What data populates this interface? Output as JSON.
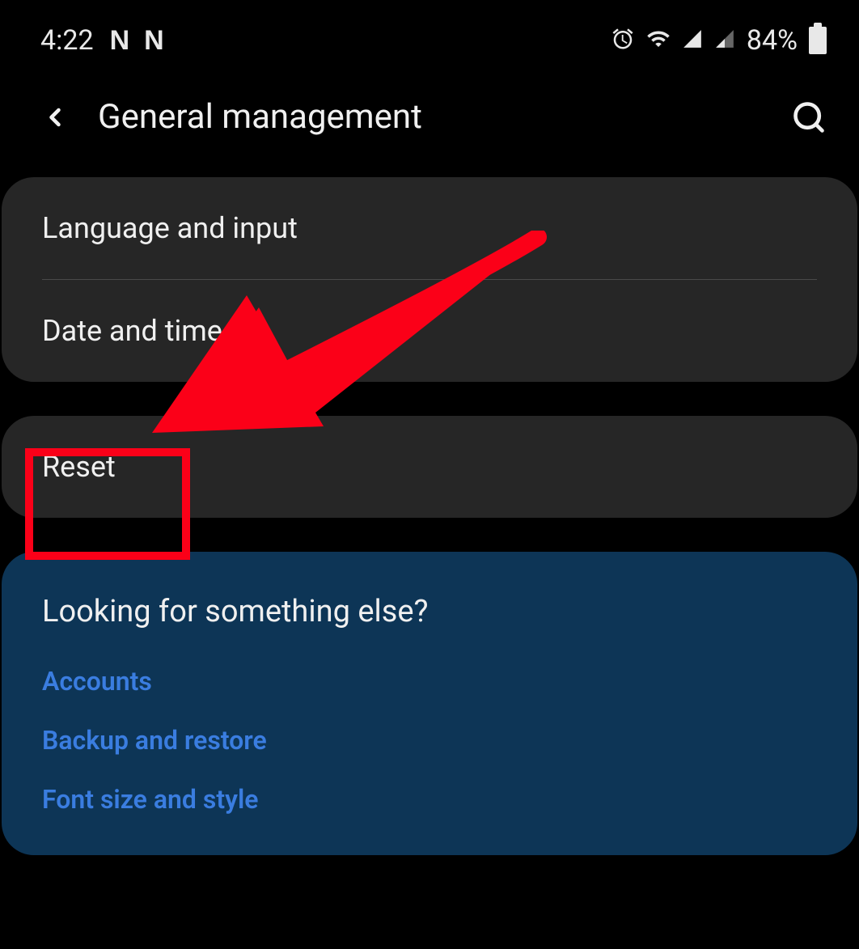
{
  "status_bar": {
    "time": "4:22",
    "app_icon_1": "N",
    "app_icon_2": "N",
    "battery_percent": "84%"
  },
  "header": {
    "title": "General management"
  },
  "settings_group_1": {
    "items": [
      {
        "label": "Language and input"
      },
      {
        "label": "Date and time"
      }
    ]
  },
  "settings_group_2": {
    "items": [
      {
        "label": "Reset"
      }
    ]
  },
  "suggestions": {
    "title": "Looking for something else?",
    "links": [
      {
        "label": "Accounts"
      },
      {
        "label": "Backup and restore"
      },
      {
        "label": "Font size and style"
      }
    ]
  }
}
